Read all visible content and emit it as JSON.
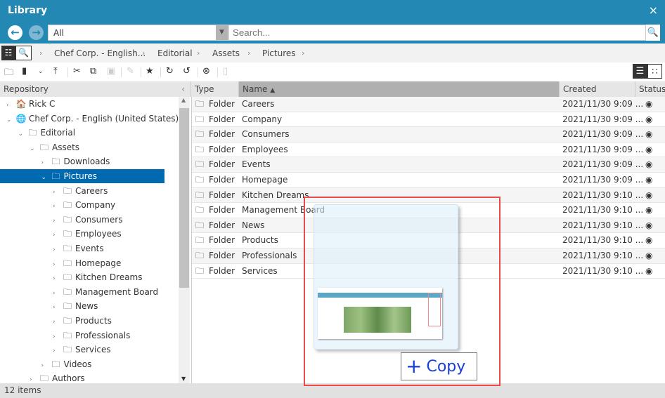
{
  "window": {
    "title": "Library",
    "close": "×"
  },
  "search": {
    "type_value": "All",
    "placeholder": "Search..."
  },
  "breadcrumb": [
    "Chef Corp. - English...",
    "Editorial",
    "Assets",
    "Pictures"
  ],
  "columns": {
    "repository": "Repository",
    "type": "Type",
    "name": "Name",
    "created": "Created",
    "status": "Status"
  },
  "tree": [
    {
      "label": "Rick C",
      "level": 0,
      "chev": "›",
      "icon": "🏠"
    },
    {
      "label": "Chef Corp. - English (United States)",
      "level": 0,
      "chev": "⌄",
      "icon": "🌐"
    },
    {
      "label": "Editorial",
      "level": 1,
      "chev": "⌄",
      "icon": "🗀"
    },
    {
      "label": "Assets",
      "level": 2,
      "chev": "⌄",
      "icon": "🗀"
    },
    {
      "label": "Downloads",
      "level": 3,
      "chev": "›",
      "icon": "🗀"
    },
    {
      "label": "Pictures",
      "level": 3,
      "chev": "⌄",
      "icon": "🗀",
      "selected": true
    },
    {
      "label": "Careers",
      "level": 4,
      "chev": "›",
      "icon": "🗀"
    },
    {
      "label": "Company",
      "level": 4,
      "chev": "›",
      "icon": "🗀"
    },
    {
      "label": "Consumers",
      "level": 4,
      "chev": "›",
      "icon": "🗀"
    },
    {
      "label": "Employees",
      "level": 4,
      "chev": "›",
      "icon": "🗀"
    },
    {
      "label": "Events",
      "level": 4,
      "chev": "›",
      "icon": "🗀"
    },
    {
      "label": "Homepage",
      "level": 4,
      "chev": "›",
      "icon": "🗀"
    },
    {
      "label": "Kitchen Dreams",
      "level": 4,
      "chev": "›",
      "icon": "🗀"
    },
    {
      "label": "Management Board",
      "level": 4,
      "chev": "›",
      "icon": "🗀"
    },
    {
      "label": "News",
      "level": 4,
      "chev": "›",
      "icon": "🗀"
    },
    {
      "label": "Products",
      "level": 4,
      "chev": "›",
      "icon": "🗀"
    },
    {
      "label": "Professionals",
      "level": 4,
      "chev": "›",
      "icon": "🗀"
    },
    {
      "label": "Services",
      "level": 4,
      "chev": "›",
      "icon": "🗀"
    },
    {
      "label": "Videos",
      "level": 3,
      "chev": "›",
      "icon": "🗀"
    },
    {
      "label": "Authors",
      "level": 2,
      "chev": "›",
      "icon": "🗀"
    }
  ],
  "rows": [
    {
      "type": "Folder",
      "name": "Careers",
      "created": "2021/11/30 9:09 ..."
    },
    {
      "type": "Folder",
      "name": "Company",
      "created": "2021/11/30 9:09 ..."
    },
    {
      "type": "Folder",
      "name": "Consumers",
      "created": "2021/11/30 9:09 ..."
    },
    {
      "type": "Folder",
      "name": "Employees",
      "created": "2021/11/30 9:09 ..."
    },
    {
      "type": "Folder",
      "name": "Events",
      "created": "2021/11/30 9:09 ..."
    },
    {
      "type": "Folder",
      "name": "Homepage",
      "created": "2021/11/30 9:09 ..."
    },
    {
      "type": "Folder",
      "name": "Kitchen Dreams",
      "created": "2021/11/30 9:10 ..."
    },
    {
      "type": "Folder",
      "name": "Management Board",
      "created": "2021/11/30 9:10 ..."
    },
    {
      "type": "Folder",
      "name": "News",
      "created": "2021/11/30 9:10 ..."
    },
    {
      "type": "Folder",
      "name": "Products",
      "created": "2021/11/30 9:10 ..."
    },
    {
      "type": "Folder",
      "name": "Professionals",
      "created": "2021/11/30 9:10 ..."
    },
    {
      "type": "Folder",
      "name": "Services",
      "created": "2021/11/30 9:10 ..."
    }
  ],
  "status_bar": "12 items",
  "drag": {
    "label": "Copy",
    "icon": "plus-icon"
  },
  "colors": {
    "titlebar": "#2488b4",
    "selection": "#0069b0",
    "drop_outline": "#e84c4c",
    "copy_text": "#1a3fd6"
  }
}
